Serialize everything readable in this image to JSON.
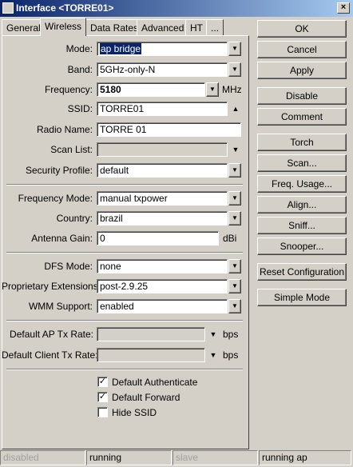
{
  "window": {
    "title": "Interface <TORRE01>"
  },
  "tabs": [
    {
      "label": "General"
    },
    {
      "label": "Wireless"
    },
    {
      "label": "Data Rates"
    },
    {
      "label": "Advanced"
    },
    {
      "label": "HT"
    },
    {
      "label": "..."
    }
  ],
  "form": {
    "mode": {
      "label": "Mode:",
      "value": "ap bridge"
    },
    "band": {
      "label": "Band:",
      "value": "5GHz-only-N"
    },
    "frequency": {
      "label": "Frequency:",
      "value": "5180",
      "unit": "MHz"
    },
    "ssid": {
      "label": "SSID:",
      "value": "TORRE01"
    },
    "radio_name": {
      "label": "Radio Name:",
      "value": "TORRE 01"
    },
    "scan_list": {
      "label": "Scan List:",
      "value": ""
    },
    "security_profile": {
      "label": "Security Profile:",
      "value": "default"
    },
    "frequency_mode": {
      "label": "Frequency Mode:",
      "value": "manual txpower"
    },
    "country": {
      "label": "Country:",
      "value": "brazil"
    },
    "antenna_gain": {
      "label": "Antenna Gain:",
      "value": "0",
      "unit": "dBi"
    },
    "dfs_mode": {
      "label": "DFS Mode:",
      "value": "none"
    },
    "proprietary_extensions": {
      "label": "Proprietary Extensions:",
      "value": "post-2.9.25"
    },
    "wmm_support": {
      "label": "WMM Support:",
      "value": "enabled"
    },
    "default_ap_tx_rate": {
      "label": "Default AP Tx Rate:",
      "value": "",
      "unit": "bps"
    },
    "default_client_tx_rate": {
      "label": "Default Client Tx Rate:",
      "value": "",
      "unit": "bps"
    },
    "default_authenticate": {
      "label": "Default Authenticate",
      "checked": true
    },
    "default_forward": {
      "label": "Default Forward",
      "checked": true
    },
    "hide_ssid": {
      "label": "Hide SSID",
      "checked": false
    }
  },
  "buttons": {
    "ok": "OK",
    "cancel": "Cancel",
    "apply": "Apply",
    "disable": "Disable",
    "comment": "Comment",
    "torch": "Torch",
    "scan": "Scan...",
    "freq_usage": "Freq. Usage...",
    "align": "Align...",
    "sniff": "Sniff...",
    "snooper": "Snooper...",
    "reset_configuration": "Reset Configuration",
    "simple_mode": "Simple Mode"
  },
  "status_bar": [
    "disabled",
    "running",
    "slave",
    "running ap"
  ],
  "glyphs": {
    "dropdown": "▼",
    "arrow_down": "▼",
    "arrow_up": "▲",
    "check": "✓",
    "close": "×"
  }
}
